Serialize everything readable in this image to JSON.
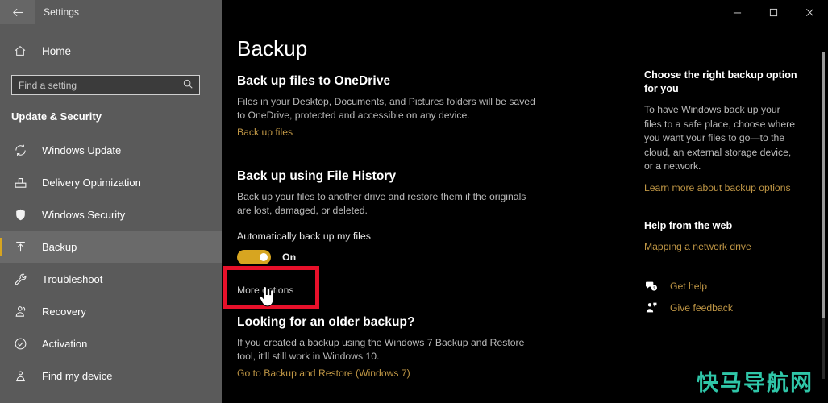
{
  "window": {
    "title": "Settings",
    "back_icon": "back-arrow-icon",
    "minimize_label": "Minimize",
    "maximize_label": "Maximize",
    "close_label": "Close"
  },
  "sidebar": {
    "home_label": "Home",
    "home_icon": "home-icon",
    "search": {
      "placeholder": "Find a setting",
      "value": "",
      "icon": "search-icon"
    },
    "group_title": "Update & Security",
    "accent_color": "#d7a520",
    "background_color": "#5a5a5a",
    "items": [
      {
        "label": "Windows Update",
        "icon": "sync-icon",
        "selected": false
      },
      {
        "label": "Delivery Optimization",
        "icon": "delivery-box-icon",
        "selected": false
      },
      {
        "label": "Windows Security",
        "icon": "shield-icon",
        "selected": false
      },
      {
        "label": "Backup",
        "icon": "upload-arrow-icon",
        "selected": true
      },
      {
        "label": "Troubleshoot",
        "icon": "wrench-icon",
        "selected": false
      },
      {
        "label": "Recovery",
        "icon": "recovery-icon",
        "selected": false
      },
      {
        "label": "Activation",
        "icon": "check-circle-icon",
        "selected": false
      },
      {
        "label": "Find my device",
        "icon": "person-pin-icon",
        "selected": false
      }
    ]
  },
  "main": {
    "page_title": "Backup",
    "link_color": "#bf9645",
    "sections": {
      "onedrive": {
        "heading": "Back up files to OneDrive",
        "body": "Files in your Desktop, Documents, and Pictures folders will be saved to OneDrive, protected and accessible on any device.",
        "link": "Back up files"
      },
      "file_history": {
        "heading": "Back up using File History",
        "body": "Back up your files to another drive and restore them if the originals are lost, damaged, or deleted.",
        "toggle_label": "Automatically back up my files",
        "toggle_state": "On",
        "toggle_on": true,
        "more_options": "More options"
      },
      "older_backup": {
        "heading": "Looking for an older backup?",
        "body": "If you created a backup using the Windows 7 Backup and Restore tool, it'll still work in Windows 10.",
        "link": "Go to Backup and Restore (Windows 7)"
      }
    },
    "annotation": {
      "target": "More options",
      "box_color": "#e8102a",
      "cursor_icon": "hand-pointer-cursor"
    }
  },
  "aside": {
    "blocks": [
      {
        "heading": "Choose the right backup option for you",
        "body": "To have Windows back up your files to a safe place, choose where you want your files to go—to the cloud, an external storage device, or a network.",
        "link": "Learn more about backup options"
      },
      {
        "heading": "Help from the web",
        "body": "",
        "link": "Mapping a network drive"
      }
    ],
    "actions": [
      {
        "label": "Get help",
        "icon": "question-bubble-icon"
      },
      {
        "label": "Give feedback",
        "icon": "feedback-person-icon"
      }
    ]
  },
  "watermark": {
    "text": "快马导航网",
    "color": "#2fc6a8"
  }
}
